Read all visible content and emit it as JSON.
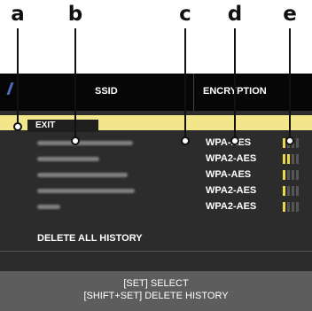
{
  "callouts": [
    "a",
    "b",
    "c",
    "d",
    "e"
  ],
  "header": {
    "ssid_label": "SSID",
    "encryption_label": "ENCRYPTION"
  },
  "list": {
    "exit_label": "EXIT",
    "rows": [
      {
        "encryption": "WPA-AES",
        "signal_bars": 1
      },
      {
        "encryption": "WPA2-AES",
        "signal_bars": 2
      },
      {
        "encryption": "WPA-AES",
        "signal_bars": 1
      },
      {
        "encryption": "WPA2-AES",
        "signal_bars": 1
      },
      {
        "encryption": "WPA2-AES",
        "signal_bars": 1
      }
    ],
    "delete_all_label": "DELETE ALL HISTORY"
  },
  "footer": {
    "line1": "[SET] SELECT",
    "line2": "[SHIFT+SET] DELETE HISTORY"
  },
  "colors": {
    "highlight": "#f3e58a",
    "signal_on": "#e8d84a",
    "screen": "#2c2c2c",
    "footer": "#5d5d5d"
  }
}
